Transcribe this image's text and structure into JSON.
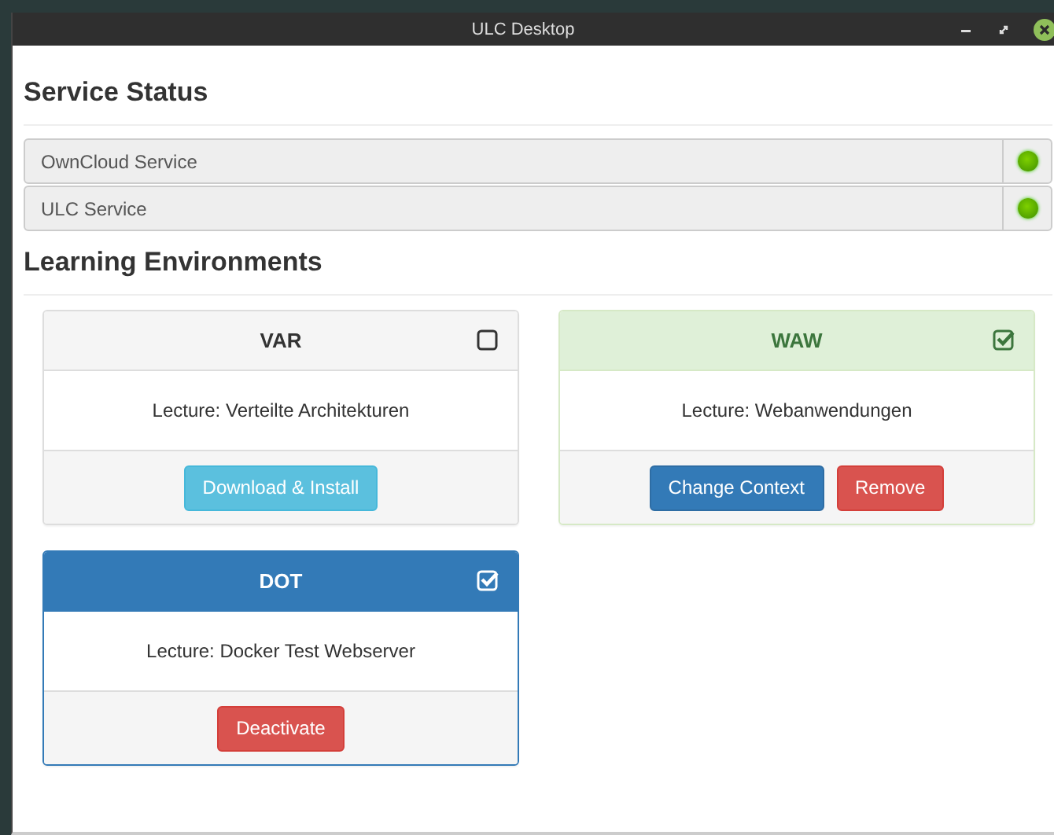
{
  "window": {
    "title": "ULC Desktop"
  },
  "service_status": {
    "heading": "Service Status",
    "services": [
      {
        "name": "OwnCloud Service",
        "on": true
      },
      {
        "name": "ULC Service",
        "on": true
      }
    ]
  },
  "learning_environments": {
    "heading": "Learning Environments",
    "cards": [
      {
        "title": "VAR",
        "kind": "default",
        "checked": false,
        "description": "Lecture: Verteilte Architekturen",
        "buttons": [
          {
            "label": "Download & Install",
            "kind": "info"
          }
        ]
      },
      {
        "title": "WAW",
        "kind": "success",
        "checked": true,
        "description": "Lecture: Webanwendungen",
        "buttons": [
          {
            "label": "Change Context",
            "kind": "primary"
          },
          {
            "label": "Remove",
            "kind": "danger"
          }
        ]
      },
      {
        "title": "DOT",
        "kind": "primary",
        "checked": true,
        "description": "Lecture: Docker Test Webserver",
        "buttons": [
          {
            "label": "Deactivate",
            "kind": "danger"
          }
        ]
      }
    ]
  }
}
